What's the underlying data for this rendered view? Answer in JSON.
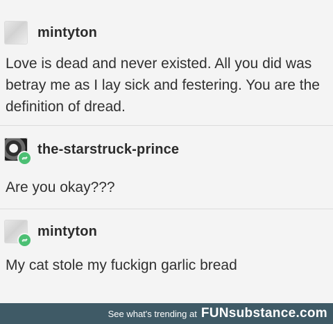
{
  "posts": [
    {
      "username": "mintyton",
      "text": "Love is dead and never existed. All you did was betray me as I lay sick and festering. You are the definition of dread.",
      "avatar": "avatar-image",
      "reblog": false
    },
    {
      "username": "the-starstruck-prince",
      "text": "Are you okay???",
      "avatar": "avatar-image",
      "reblog": true
    },
    {
      "username": "mintyton",
      "text": "My cat stole my fuckign garlic bread",
      "avatar": "avatar-image",
      "reblog": true
    }
  ],
  "footer": {
    "tagline": "See what's trending at",
    "brand": "FUNsubstance.com"
  },
  "colors": {
    "reblog_badge": "#4bbf73",
    "footer_bg": "#3f5a66",
    "background": "#f4f4f4"
  }
}
